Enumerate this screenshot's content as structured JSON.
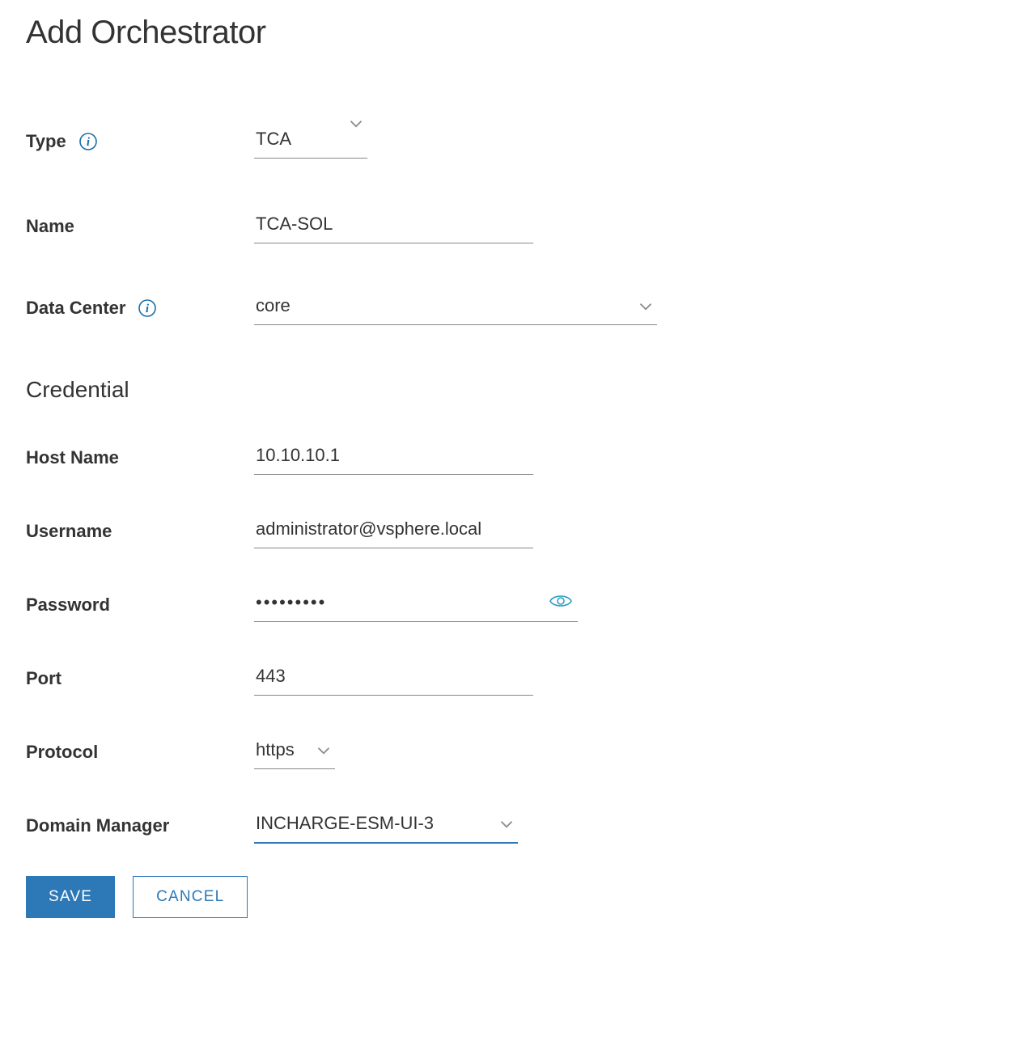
{
  "title": "Add Orchestrator",
  "labels": {
    "type": "Type",
    "name": "Name",
    "dataCenter": "Data Center",
    "credentialHeader": "Credential",
    "hostName": "Host Name",
    "username": "Username",
    "password": "Password",
    "port": "Port",
    "protocol": "Protocol",
    "domainManager": "Domain Manager"
  },
  "values": {
    "type": "TCA",
    "name": "TCA-SOL",
    "dataCenter": "core",
    "hostName": "10.10.10.1",
    "username": "administrator@vsphere.local",
    "passwordMasked": "•••••••••",
    "port": "443",
    "protocol": "https",
    "domainManager": "INCHARGE-ESM-UI-3"
  },
  "buttons": {
    "save": "SAVE",
    "cancel": "CANCEL"
  }
}
